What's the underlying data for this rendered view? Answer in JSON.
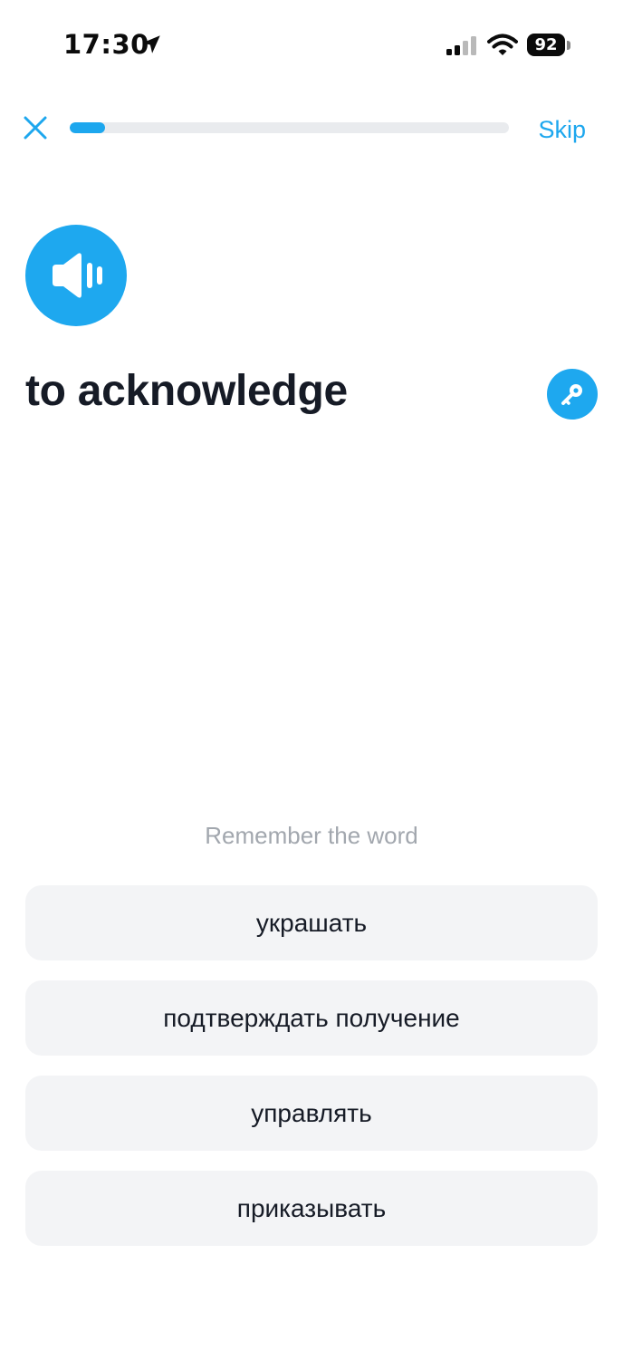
{
  "status_bar": {
    "time": "17:30",
    "battery_level": "92",
    "icons": [
      "location-arrow-icon",
      "signal-icon",
      "wifi-icon",
      "battery-icon"
    ]
  },
  "top_bar": {
    "close_icon": "close-icon",
    "skip_label": "Skip",
    "progress_fraction": 0.08
  },
  "card": {
    "speaker_icon": "speaker-icon",
    "word": "to acknowledge",
    "hint_icon": "key-icon"
  },
  "quiz": {
    "instruction": "Remember the word",
    "options": [
      {
        "label": "украшать"
      },
      {
        "label": "подтверждать получение"
      },
      {
        "label": "управлять"
      },
      {
        "label": "приказывать"
      }
    ]
  },
  "colors": {
    "accent": "#1da7ee",
    "text": "#161b26",
    "muted": "#a2a7ae",
    "option_bg": "#f3f4f6",
    "track": "#e9ebee"
  }
}
